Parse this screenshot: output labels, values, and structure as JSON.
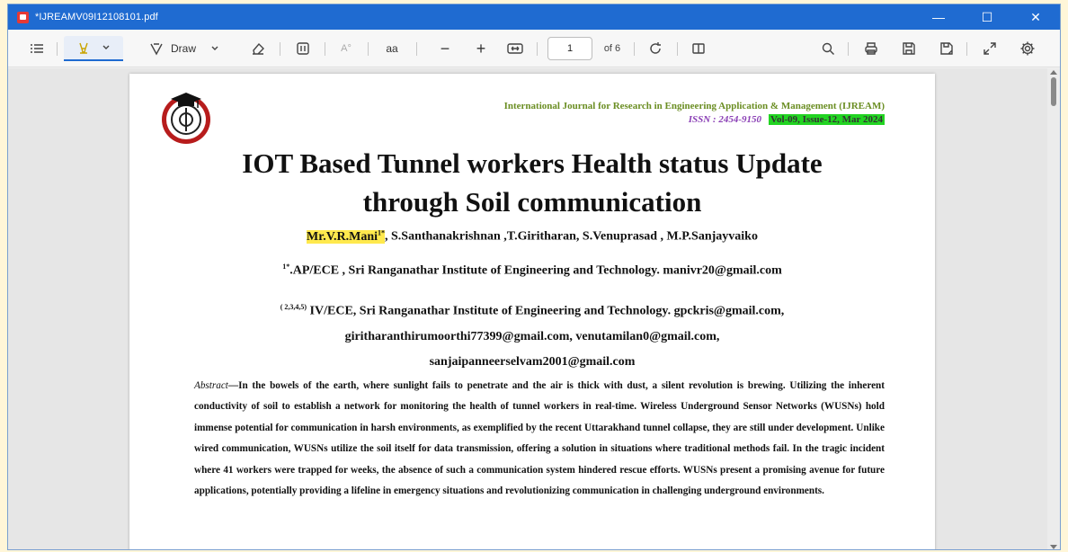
{
  "window": {
    "title": "*IJREAMV09I12108101.pdf",
    "controls": {
      "minimize": "—",
      "maximize": "☐",
      "close": "✕"
    }
  },
  "toolbar": {
    "draw_label": "Draw",
    "text_size_label": "A°",
    "read_aloud_label": "aа",
    "zoom_out": "−",
    "zoom_in": "+",
    "page_current": "1",
    "page_total": "of 6"
  },
  "paper": {
    "journal": "International Journal for Research in Engineering Application & Management (IJREAM)",
    "issn": "ISSN : 2454-9150",
    "volume": "Vol-09,  Issue-12, Mar 2024",
    "title_line1": "IOT Based Tunnel workers Health status Update",
    "title_line2": "through Soil communication",
    "author_highlight": "Mr.V.R.Mani",
    "author_highlight_sup": "1*",
    "authors_rest": ", S.Santhanakrishnan ,T.Giritharan, S.Venuprasad , M.P.Sanjayvaiko",
    "aff1_sup": "1*",
    "aff1_text": ".AP/ECE , Sri Ranganathar Institute of Engineering and Technology. manivr20@gmail.com",
    "aff2_sup": "( 2,3,4,5)",
    "aff2_line1": " IV/ECE, Sri Ranganathar Institute of Engineering and Technology. gpckris@gmail.com,",
    "aff2_line2": "giritharanthirumoorthi77399@gmail.com, venutamilan0@gmail.com,",
    "aff2_line3": "sanjaipanneerselvam2001@gmail.com",
    "abstract_label": "Abstract",
    "abstract_text": "—In the bowels of the earth, where sunlight fails to penetrate and the air is thick with dust, a silent revolution is brewing. Utilizing the inherent conductivity of soil to establish a network for monitoring the health of tunnel workers in real-time. Wireless Underground Sensor Networks (WUSNs) hold immense potential for communication in harsh environments, as exemplified by the recent Uttarakhand tunnel collapse, they are still under development. Unlike wired communication, WUSNs utilize the soil itself for data transmission, offering a solution in situations where traditional methods fail. In the tragic incident where 41 workers were trapped for weeks, the absence of such a communication system hindered rescue efforts. WUSNs present a promising avenue for future applications, potentially providing a lifeline in emergency situations and revolutionizing communication in challenging underground environments."
  }
}
